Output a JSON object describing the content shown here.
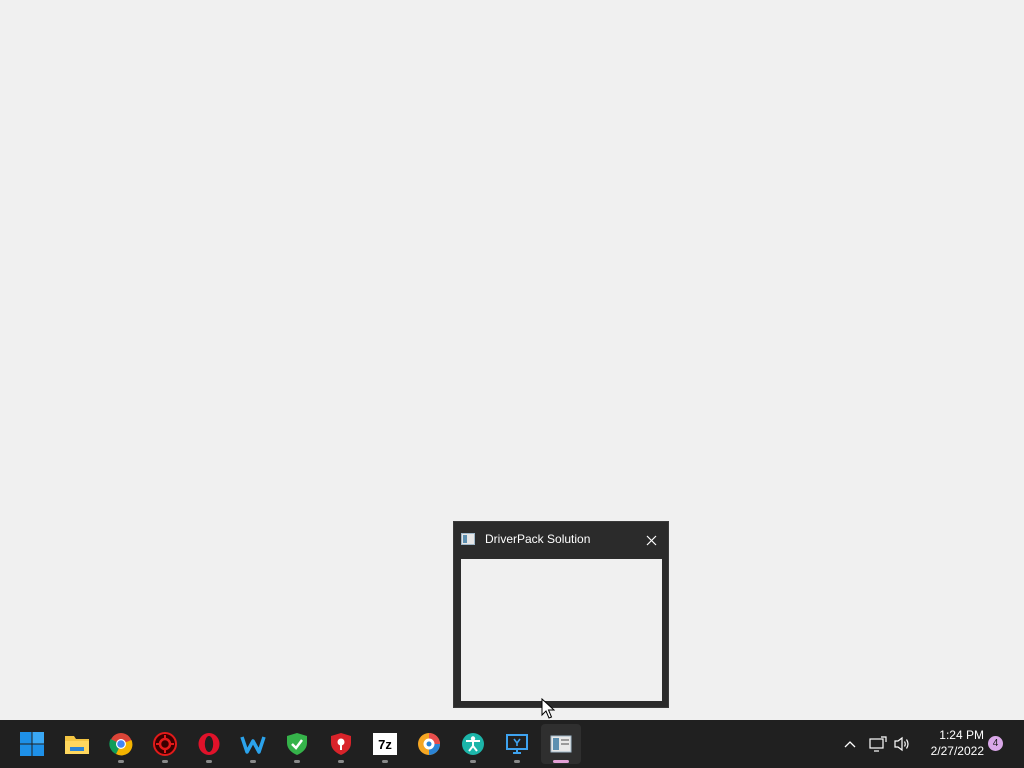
{
  "preview": {
    "title": "DriverPack Solution",
    "app_icon": "driverpack-window-icon",
    "close_icon": "close-icon"
  },
  "taskbar": {
    "apps": [
      {
        "name": "start-button",
        "icon": "windows-logo-icon"
      },
      {
        "name": "file-explorer",
        "icon": "folder-icon"
      },
      {
        "name": "chrome",
        "icon": "chrome-icon"
      },
      {
        "name": "red-gear-app",
        "icon": "red-gear-icon"
      },
      {
        "name": "opera",
        "icon": "opera-icon"
      },
      {
        "name": "waterfox",
        "icon": "w-icon"
      },
      {
        "name": "green-shield-app",
        "icon": "green-shield-icon"
      },
      {
        "name": "red-shield-app",
        "icon": "red-shield-icon"
      },
      {
        "name": "7zip",
        "icon": "7z-icon"
      },
      {
        "name": "colorful-browser",
        "icon": "circle-browser-icon"
      },
      {
        "name": "accessibility-app",
        "icon": "person-icon"
      },
      {
        "name": "remote-desktop",
        "icon": "monitor-icon"
      },
      {
        "name": "driverpack",
        "icon": "driverpack-window-icon"
      }
    ],
    "seven_zip_label": "7z"
  },
  "tray": {
    "time": "1:24 PM",
    "date": "2/27/2022",
    "notification_count": "4"
  }
}
